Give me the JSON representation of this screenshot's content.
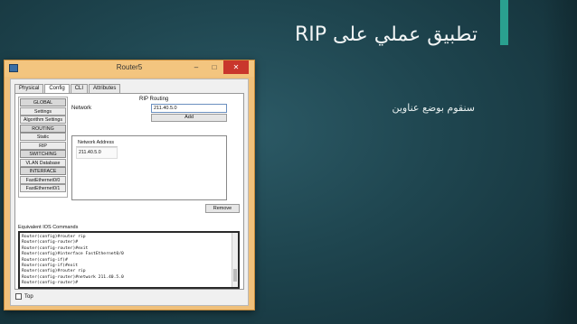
{
  "slide": {
    "title": "تطبيق عملي على RIP",
    "body": "سنقوم بوضع عناوين"
  },
  "window": {
    "title": "Router5",
    "minimize": "–",
    "maximize": "□",
    "close": "✕"
  },
  "tabs": [
    "Physical",
    "Config",
    "CLI",
    "Attributes"
  ],
  "sidebar": {
    "items": [
      "GLOBAL",
      "Settings",
      "Algorithm Settings",
      "ROUTING",
      "Static",
      "RIP",
      "SWITCHING",
      "VLAN Database",
      "INTERFACE",
      "FastEthernet0/0",
      "FastEthernet0/1"
    ]
  },
  "rip": {
    "title": "RIP Routing",
    "network_label": "Network",
    "network_value": "211.40.5.0",
    "add_label": "Add",
    "list_header": "Network Address",
    "list_items": [
      "211.40.5.0"
    ],
    "remove_label": "Remove"
  },
  "console": {
    "label": "Equivalent IOS Commands",
    "lines": [
      "Router(config)#router rip",
      "Router(config-router)#",
      "Router(config-router)#exit",
      "Router(config)#interface FastEthernet0/0",
      "Router(config-if)#",
      "Router(config-if)#exit",
      "Router(config)#router rip",
      "Router(config-router)#network 211.40.5.0",
      "Router(config-router)#"
    ]
  },
  "footer": {
    "top_label": "Top"
  }
}
